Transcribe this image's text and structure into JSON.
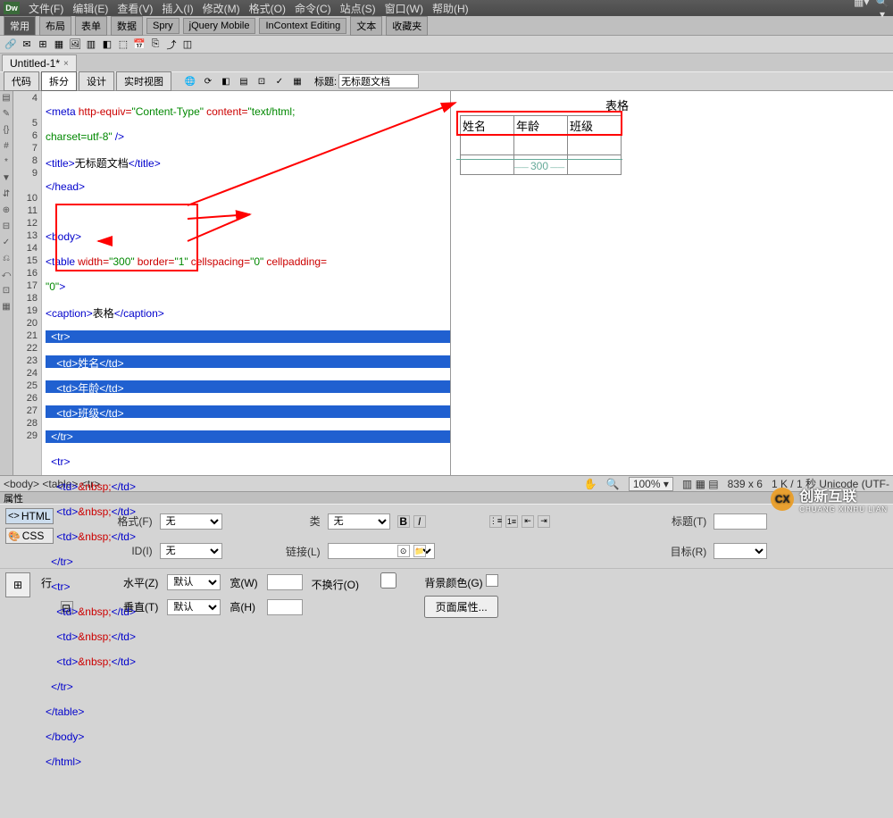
{
  "app": {
    "logo": "Dw"
  },
  "menus": [
    "文件(F)",
    "编辑(E)",
    "查看(V)",
    "插入(I)",
    "修改(M)",
    "格式(O)",
    "命令(C)",
    "站点(S)",
    "窗口(W)",
    "帮助(H)"
  ],
  "insert_categories": [
    "常用",
    "布局",
    "表单",
    "数据",
    "Spry",
    "jQuery Mobile",
    "InContext Editing",
    "文本",
    "收藏夹"
  ],
  "doc_tab": {
    "name": "Untitled-1*",
    "close": "×"
  },
  "view_buttons": {
    "code": "代码",
    "split": "拆分",
    "design": "设计",
    "live": "实时视图"
  },
  "title_field": {
    "label": "标题:",
    "value": "无标题文档"
  },
  "code_lines": {
    "4": "<meta http-equiv=\"Content-Type\" content=\"text/html;",
    "4b": "charset=utf-8\" />",
    "5": "<title>无标题文档</title>",
    "6": "</head>",
    "7": "",
    "8": "<body>",
    "9": "<table width=\"300\" border=\"1\" cellspacing=\"0\" cellpadding=",
    "9b": "\"0\">",
    "10": "<caption>表格</caption>",
    "11": "  <tr>",
    "12": "    <td>姓名</td>",
    "13": "    <td>年龄</td>",
    "14": "    <td>班级</td>",
    "15": "  </tr>",
    "16": "  <tr>",
    "17": "    <td>&nbsp;</td>",
    "18": "    <td>&nbsp;</td>",
    "19": "    <td>&nbsp;</td>",
    "20": "  </tr>",
    "21": "  <tr>",
    "22": "    <td>&nbsp;</td>",
    "23": "    <td>&nbsp;</td>",
    "24": "    <td>&nbsp;</td>",
    "25": "  </tr>",
    "26": "</table>",
    "27": "</body>",
    "28": "</html>",
    "29": ""
  },
  "line_numbers": [
    "4",
    "",
    "5",
    "6",
    "7",
    "8",
    "9",
    "",
    "10",
    "11",
    "12",
    "13",
    "14",
    "15",
    "16",
    "17",
    "18",
    "19",
    "20",
    "21",
    "22",
    "23",
    "24",
    "25",
    "26",
    "27",
    "28",
    "29"
  ],
  "preview": {
    "caption": "表格",
    "headers": [
      "姓名",
      "年龄",
      "班级"
    ],
    "ruler": "300"
  },
  "status": {
    "path": "<body> <table> <tr>",
    "zoom": "100%",
    "dims": "839 x 6",
    "info": "1 K / 1 秒 Unicode (UTF-"
  },
  "prop_header": "属性",
  "prop": {
    "html_btn": "HTML",
    "css_btn": "CSS",
    "format_label": "格式(F)",
    "format_val": "无",
    "id_label": "ID(I)",
    "id_val": "无",
    "class_label": "类",
    "class_val": "无",
    "link_label": "链接(L)",
    "title2": "标题(T)",
    "target": "目标(R)"
  },
  "prop2": {
    "row_label": "行",
    "halign": "水平(Z)",
    "halign_val": "默认",
    "valign": "垂直(T)",
    "valign_val": "默认",
    "width": "宽(W)",
    "nowrap": "不换行(O)",
    "bg": "背景颜色(G)",
    "height": "高(H)",
    "page_props": "页面属性..."
  },
  "watermark": {
    "brand": "创新互联",
    "sub": "CHUANG XINHU LIAN"
  }
}
